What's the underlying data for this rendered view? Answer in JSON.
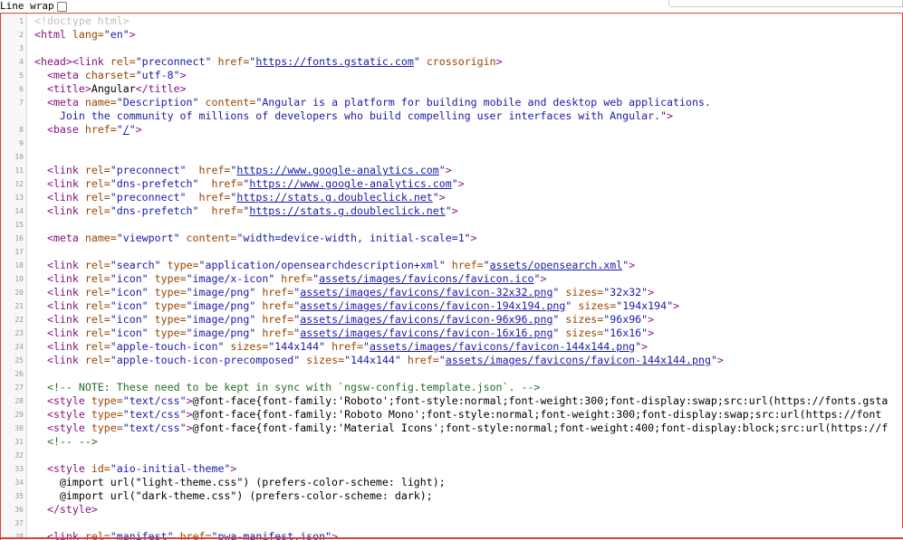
{
  "toolbar": {
    "line_wrap_label": "Line wrap",
    "line_wrap_checked": false
  },
  "lines": [
    {
      "n": "1",
      "seg": [
        [
          "d",
          "<!doctype html>"
        ]
      ]
    },
    {
      "n": "2",
      "seg": [
        [
          "t",
          "<html "
        ],
        [
          "a",
          "lang="
        ],
        [
          "v",
          "\"en\""
        ],
        [
          "t",
          ">"
        ]
      ]
    },
    {
      "n": "3",
      "seg": []
    },
    {
      "n": "4",
      "seg": [
        [
          "t",
          "<head><link "
        ],
        [
          "a",
          "rel="
        ],
        [
          "v",
          "\"preconnect\" "
        ],
        [
          "a",
          "href="
        ],
        [
          "v",
          "\""
        ],
        [
          "l",
          "https://fonts.gstatic.com"
        ],
        [
          "v",
          "\" "
        ],
        [
          "a",
          "crossorigin"
        ],
        [
          "t",
          ">"
        ]
      ]
    },
    {
      "n": "5",
      "seg": [
        [
          "x",
          "  "
        ],
        [
          "t",
          "<meta "
        ],
        [
          "a",
          "charset="
        ],
        [
          "v",
          "\"utf-8\""
        ],
        [
          "t",
          ">"
        ]
      ]
    },
    {
      "n": "6",
      "seg": [
        [
          "x",
          "  "
        ],
        [
          "t",
          "<title>"
        ],
        [
          "x",
          "Angular"
        ],
        [
          "t",
          "</title>"
        ]
      ]
    },
    {
      "n": "7",
      "seg": [
        [
          "x",
          "  "
        ],
        [
          "t",
          "<meta "
        ],
        [
          "a",
          "name="
        ],
        [
          "v",
          "\"Description\" "
        ],
        [
          "a",
          "content="
        ],
        [
          "v",
          "\"Angular is a platform for building mobile and desktop web applications."
        ]
      ]
    },
    {
      "n": "",
      "cont": true,
      "seg": [
        [
          "v",
          "    Join the community of millions of developers who build compelling user interfaces with Angular.\""
        ],
        [
          "t",
          ">"
        ]
      ]
    },
    {
      "n": "8",
      "seg": [
        [
          "x",
          "  "
        ],
        [
          "t",
          "<base "
        ],
        [
          "a",
          "href="
        ],
        [
          "v",
          "\""
        ],
        [
          "l",
          "/"
        ],
        [
          "v",
          "\""
        ],
        [
          "t",
          ">"
        ]
      ]
    },
    {
      "n": "9",
      "seg": []
    },
    {
      "n": "10",
      "seg": []
    },
    {
      "n": "11",
      "seg": [
        [
          "x",
          "  "
        ],
        [
          "t",
          "<link "
        ],
        [
          "a",
          "rel="
        ],
        [
          "v",
          "\"preconnect\"  "
        ],
        [
          "a",
          "href="
        ],
        [
          "v",
          "\""
        ],
        [
          "l",
          "https://www.google-analytics.com"
        ],
        [
          "v",
          "\""
        ],
        [
          "t",
          ">"
        ]
      ]
    },
    {
      "n": "12",
      "seg": [
        [
          "x",
          "  "
        ],
        [
          "t",
          "<link "
        ],
        [
          "a",
          "rel="
        ],
        [
          "v",
          "\"dns-prefetch\"  "
        ],
        [
          "a",
          "href="
        ],
        [
          "v",
          "\""
        ],
        [
          "l",
          "https://www.google-analytics.com"
        ],
        [
          "v",
          "\""
        ],
        [
          "t",
          ">"
        ]
      ]
    },
    {
      "n": "13",
      "seg": [
        [
          "x",
          "  "
        ],
        [
          "t",
          "<link "
        ],
        [
          "a",
          "rel="
        ],
        [
          "v",
          "\"preconnect\"  "
        ],
        [
          "a",
          "href="
        ],
        [
          "v",
          "\""
        ],
        [
          "l",
          "https://stats.g.doubleclick.net"
        ],
        [
          "v",
          "\""
        ],
        [
          "t",
          ">"
        ]
      ]
    },
    {
      "n": "14",
      "seg": [
        [
          "x",
          "  "
        ],
        [
          "t",
          "<link "
        ],
        [
          "a",
          "rel="
        ],
        [
          "v",
          "\"dns-prefetch\"  "
        ],
        [
          "a",
          "href="
        ],
        [
          "v",
          "\""
        ],
        [
          "l",
          "https://stats.g.doubleclick.net"
        ],
        [
          "v",
          "\""
        ],
        [
          "t",
          ">"
        ]
      ]
    },
    {
      "n": "15",
      "seg": []
    },
    {
      "n": "16",
      "seg": [
        [
          "x",
          "  "
        ],
        [
          "t",
          "<meta "
        ],
        [
          "a",
          "name="
        ],
        [
          "v",
          "\"viewport\" "
        ],
        [
          "a",
          "content="
        ],
        [
          "v",
          "\"width=device-width, initial-scale=1\""
        ],
        [
          "t",
          ">"
        ]
      ]
    },
    {
      "n": "17",
      "seg": []
    },
    {
      "n": "18",
      "seg": [
        [
          "x",
          "  "
        ],
        [
          "t",
          "<link "
        ],
        [
          "a",
          "rel="
        ],
        [
          "v",
          "\"search\" "
        ],
        [
          "a",
          "type="
        ],
        [
          "v",
          "\"application/opensearchdescription+xml\" "
        ],
        [
          "a",
          "href="
        ],
        [
          "v",
          "\""
        ],
        [
          "l",
          "assets/opensearch.xml"
        ],
        [
          "v",
          "\""
        ],
        [
          "t",
          ">"
        ]
      ]
    },
    {
      "n": "19",
      "seg": [
        [
          "x",
          "  "
        ],
        [
          "t",
          "<link "
        ],
        [
          "a",
          "rel="
        ],
        [
          "v",
          "\"icon\" "
        ],
        [
          "a",
          "type="
        ],
        [
          "v",
          "\"image/x-icon\" "
        ],
        [
          "a",
          "href="
        ],
        [
          "v",
          "\""
        ],
        [
          "l",
          "assets/images/favicons/favicon.ico"
        ],
        [
          "v",
          "\""
        ],
        [
          "t",
          ">"
        ]
      ]
    },
    {
      "n": "20",
      "seg": [
        [
          "x",
          "  "
        ],
        [
          "t",
          "<link "
        ],
        [
          "a",
          "rel="
        ],
        [
          "v",
          "\"icon\" "
        ],
        [
          "a",
          "type="
        ],
        [
          "v",
          "\"image/png\" "
        ],
        [
          "a",
          "href="
        ],
        [
          "v",
          "\""
        ],
        [
          "l",
          "assets/images/favicons/favicon-32x32.png"
        ],
        [
          "v",
          "\" "
        ],
        [
          "a",
          "sizes="
        ],
        [
          "v",
          "\"32x32\""
        ],
        [
          "t",
          ">"
        ]
      ]
    },
    {
      "n": "21",
      "seg": [
        [
          "x",
          "  "
        ],
        [
          "t",
          "<link "
        ],
        [
          "a",
          "rel="
        ],
        [
          "v",
          "\"icon\" "
        ],
        [
          "a",
          "type="
        ],
        [
          "v",
          "\"image/png\" "
        ],
        [
          "a",
          "href="
        ],
        [
          "v",
          "\""
        ],
        [
          "l",
          "assets/images/favicons/favicon-194x194.png"
        ],
        [
          "v",
          "\" "
        ],
        [
          "a",
          "sizes="
        ],
        [
          "v",
          "\"194x194\""
        ],
        [
          "t",
          ">"
        ]
      ]
    },
    {
      "n": "22",
      "seg": [
        [
          "x",
          "  "
        ],
        [
          "t",
          "<link "
        ],
        [
          "a",
          "rel="
        ],
        [
          "v",
          "\"icon\" "
        ],
        [
          "a",
          "type="
        ],
        [
          "v",
          "\"image/png\" "
        ],
        [
          "a",
          "href="
        ],
        [
          "v",
          "\""
        ],
        [
          "l",
          "assets/images/favicons/favicon-96x96.png"
        ],
        [
          "v",
          "\" "
        ],
        [
          "a",
          "sizes="
        ],
        [
          "v",
          "\"96x96\""
        ],
        [
          "t",
          ">"
        ]
      ]
    },
    {
      "n": "23",
      "seg": [
        [
          "x",
          "  "
        ],
        [
          "t",
          "<link "
        ],
        [
          "a",
          "rel="
        ],
        [
          "v",
          "\"icon\" "
        ],
        [
          "a",
          "type="
        ],
        [
          "v",
          "\"image/png\" "
        ],
        [
          "a",
          "href="
        ],
        [
          "v",
          "\""
        ],
        [
          "l",
          "assets/images/favicons/favicon-16x16.png"
        ],
        [
          "v",
          "\" "
        ],
        [
          "a",
          "sizes="
        ],
        [
          "v",
          "\"16x16\""
        ],
        [
          "t",
          ">"
        ]
      ]
    },
    {
      "n": "24",
      "seg": [
        [
          "x",
          "  "
        ],
        [
          "t",
          "<link "
        ],
        [
          "a",
          "rel="
        ],
        [
          "v",
          "\"apple-touch-icon\" "
        ],
        [
          "a",
          "sizes="
        ],
        [
          "v",
          "\"144x144\" "
        ],
        [
          "a",
          "href="
        ],
        [
          "v",
          "\""
        ],
        [
          "l",
          "assets/images/favicons/favicon-144x144.png"
        ],
        [
          "v",
          "\""
        ],
        [
          "t",
          ">"
        ]
      ]
    },
    {
      "n": "25",
      "seg": [
        [
          "x",
          "  "
        ],
        [
          "t",
          "<link "
        ],
        [
          "a",
          "rel="
        ],
        [
          "v",
          "\"apple-touch-icon-precomposed\" "
        ],
        [
          "a",
          "sizes="
        ],
        [
          "v",
          "\"144x144\" "
        ],
        [
          "a",
          "href="
        ],
        [
          "v",
          "\""
        ],
        [
          "l",
          "assets/images/favicons/favicon-144x144.png"
        ],
        [
          "v",
          "\""
        ],
        [
          "t",
          ">"
        ]
      ]
    },
    {
      "n": "26",
      "seg": []
    },
    {
      "n": "27",
      "seg": [
        [
          "x",
          "  "
        ],
        [
          "c",
          "<!-- NOTE: These need to be kept in sync with `ngsw-config.template.json`. -->"
        ]
      ]
    },
    {
      "n": "28",
      "seg": [
        [
          "x",
          "  "
        ],
        [
          "t",
          "<style "
        ],
        [
          "a",
          "type="
        ],
        [
          "v",
          "\"text/css\""
        ],
        [
          "t",
          ">"
        ],
        [
          "x",
          "@font-face{font-family:'Roboto';font-style:normal;font-weight:300;font-display:swap;src:url(https://fonts.gsta"
        ]
      ]
    },
    {
      "n": "29",
      "seg": [
        [
          "x",
          "  "
        ],
        [
          "t",
          "<style "
        ],
        [
          "a",
          "type="
        ],
        [
          "v",
          "\"text/css\""
        ],
        [
          "t",
          ">"
        ],
        [
          "x",
          "@font-face{font-family:'Roboto Mono';font-style:normal;font-weight:300;font-display:swap;src:url(https://font"
        ]
      ]
    },
    {
      "n": "30",
      "seg": [
        [
          "x",
          "  "
        ],
        [
          "t",
          "<style "
        ],
        [
          "a",
          "type="
        ],
        [
          "v",
          "\"text/css\""
        ],
        [
          "t",
          ">"
        ],
        [
          "x",
          "@font-face{font-family:'Material Icons';font-style:normal;font-weight:400;font-display:block;src:url(https://f"
        ]
      ]
    },
    {
      "n": "31",
      "seg": [
        [
          "x",
          "  "
        ],
        [
          "c",
          "<!-- -->"
        ]
      ]
    },
    {
      "n": "32",
      "seg": []
    },
    {
      "n": "33",
      "seg": [
        [
          "x",
          "  "
        ],
        [
          "t",
          "<style "
        ],
        [
          "a",
          "id="
        ],
        [
          "v",
          "\"aio-initial-theme\""
        ],
        [
          "t",
          ">"
        ]
      ]
    },
    {
      "n": "34",
      "seg": [
        [
          "x",
          "    @import url(\"light-theme.css\") (prefers-color-scheme: light);"
        ]
      ]
    },
    {
      "n": "35",
      "seg": [
        [
          "x",
          "    @import url(\"dark-theme.css\") (prefers-color-scheme: dark);"
        ]
      ]
    },
    {
      "n": "36",
      "seg": [
        [
          "x",
          "  "
        ],
        [
          "t",
          "</style>"
        ]
      ]
    },
    {
      "n": "37",
      "seg": []
    },
    {
      "n": "38",
      "seg": [
        [
          "x",
          "  "
        ],
        [
          "t",
          "<link "
        ],
        [
          "a",
          "rel="
        ],
        [
          "v",
          "\"manifest\" "
        ],
        [
          "a",
          "href="
        ],
        [
          "v",
          "\""
        ],
        [
          "l",
          "pwa-manifest.json"
        ],
        [
          "v",
          "\""
        ],
        [
          "t",
          ">"
        ]
      ]
    },
    {
      "n": "39",
      "seg": [
        [
          "x",
          "  "
        ],
        [
          "t",
          "<meta "
        ],
        [
          "a",
          "name="
        ],
        [
          "v",
          "\"theme-color\" "
        ],
        [
          "a",
          "content="
        ],
        [
          "v",
          "\"#1976d2\""
        ],
        [
          "t",
          ">"
        ]
      ]
    }
  ]
}
